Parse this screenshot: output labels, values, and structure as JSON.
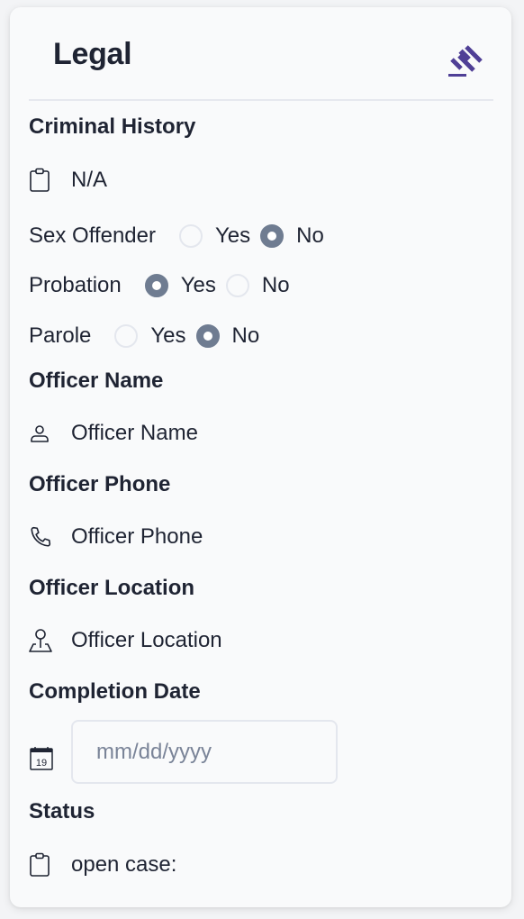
{
  "card": {
    "title": "Legal",
    "title_icon": "gavel-icon",
    "accent_color": "#4f3f96"
  },
  "criminal_history": {
    "label": "Criminal History",
    "icon": "clipboard-icon",
    "value": "N/A"
  },
  "radios": [
    {
      "label": "Sex Offender",
      "options": [
        "Yes",
        "No"
      ],
      "selected": "No"
    },
    {
      "label": "Probation",
      "options": [
        "Yes",
        "No"
      ],
      "selected": "Yes"
    },
    {
      "label": "Parole",
      "options": [
        "Yes",
        "No"
      ],
      "selected": "No"
    }
  ],
  "officer_name": {
    "label": "Officer Name",
    "icon": "user-icon",
    "value": "Officer Name"
  },
  "officer_phone": {
    "label": "Officer Phone",
    "icon": "phone-icon",
    "value": "Officer Phone"
  },
  "officer_location": {
    "label": "Officer Location",
    "icon": "location-pin-icon",
    "value": "Officer Location"
  },
  "completion_date": {
    "label": "Completion Date",
    "icon": "calendar-icon",
    "icon_day": "19",
    "value": "",
    "placeholder": "mm/dd/yyyy"
  },
  "status": {
    "label": "Status",
    "icon": "clipboard-icon",
    "value": "open case:"
  }
}
